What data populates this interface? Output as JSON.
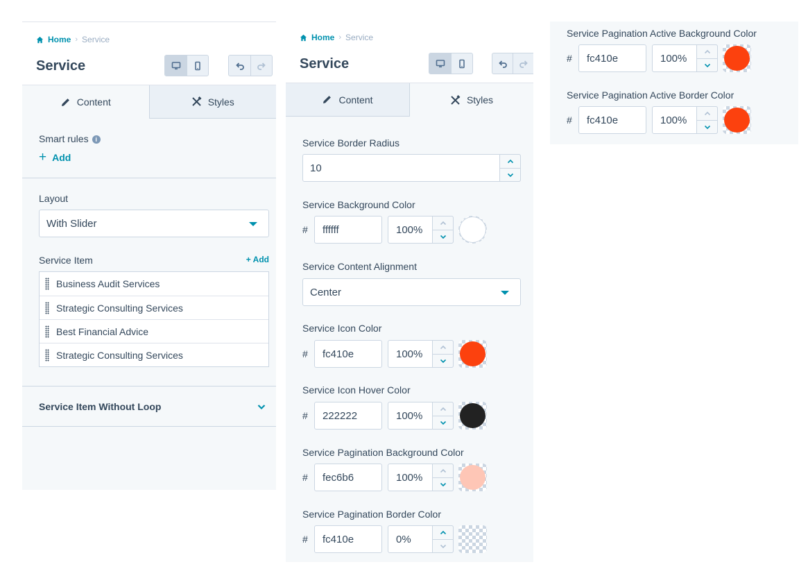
{
  "breadcrumb": {
    "home": "Home",
    "separator": "›",
    "current": "Service"
  },
  "module_title": "Service",
  "tabs": {
    "content": "Content",
    "styles": "Styles"
  },
  "icons": {
    "home": "home-icon",
    "desktop": "desktop-icon",
    "mobile": "mobile-icon",
    "undo": "undo-icon",
    "redo": "redo-icon",
    "content_tab": "pencil-icon",
    "styles_tab": "styles-icon",
    "info": "info-icon",
    "drag": "drag-handle-icon",
    "expand": "chevron-down-icon",
    "increment": "chevron-up-icon",
    "decrement": "chevron-down-icon"
  },
  "colors": {
    "accent": "#0091ae",
    "text": "#33475b",
    "panel": "#f5f8fa",
    "border": "#cbd6e2"
  },
  "content_panel": {
    "smart_rules": {
      "label": "Smart rules",
      "info": "i",
      "add_plus": "+",
      "add_label": "Add"
    },
    "layout": {
      "label": "Layout",
      "value": "With Slider"
    },
    "service_item": {
      "label": "Service Item",
      "add_label": "+ Add",
      "items": [
        "Business Audit Services",
        "Strategic Consulting Services",
        "Best Financial Advice",
        "Strategic Consulting Services"
      ]
    },
    "without_loop": {
      "label": "Service Item Without Loop"
    }
  },
  "styles_panel": {
    "border_radius": {
      "label": "Service Border Radius",
      "value": "10"
    },
    "background_color": {
      "label": "Service Background Color",
      "hash": "#",
      "hex": "ffffff",
      "opacity": "100%",
      "swatch": "#ffffff"
    },
    "content_alignment": {
      "label": "Service Content Alignment",
      "value": "Center"
    },
    "icon_color": {
      "label": "Service Icon Color",
      "hash": "#",
      "hex": "fc410e",
      "opacity": "100%",
      "swatch": "#fc410e"
    },
    "icon_hover_color": {
      "label": "Service Icon Hover Color",
      "hash": "#",
      "hex": "222222",
      "opacity": "100%",
      "swatch": "#222222"
    },
    "pagination_background_color": {
      "label": "Service Pagination Background Color",
      "hash": "#",
      "hex": "fec6b6",
      "opacity": "100%",
      "swatch": "#fec6b6"
    },
    "pagination_border_color": {
      "label": "Service Pagination Border Color",
      "hash": "#",
      "hex": "fc410e",
      "opacity": "0%",
      "swatch": "transparent"
    }
  },
  "pagination_active_panel": {
    "background_color": {
      "label": "Service Pagination Active Background Color",
      "hash": "#",
      "hex": "fc410e",
      "opacity": "100%",
      "swatch": "#fc410e"
    },
    "border_color": {
      "label": "Service Pagination Active Border Color",
      "hash": "#",
      "hex": "fc410e",
      "opacity": "100%",
      "swatch": "#fc410e"
    }
  }
}
